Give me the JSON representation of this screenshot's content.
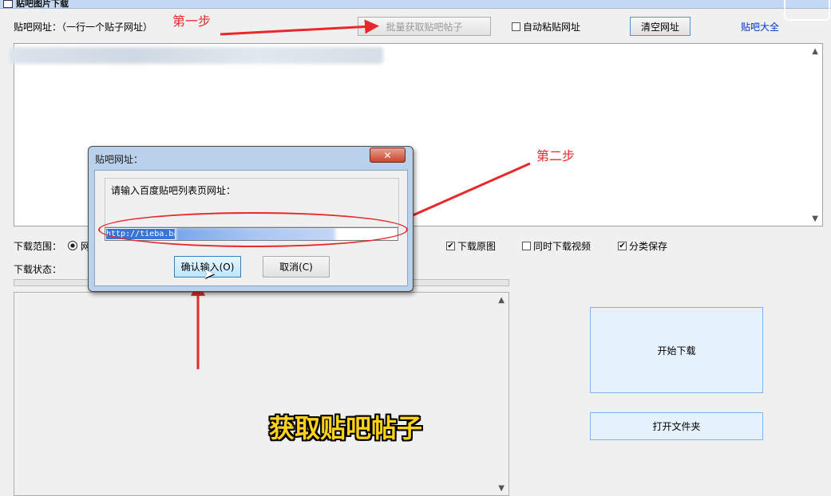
{
  "window": {
    "title": "贴吧图片下载"
  },
  "header": {
    "url_label": "贴吧网址：（一行一个贴子网址）",
    "batch_button": "批量获取贴吧帖子",
    "auto_paste_label": "自动粘贴网址",
    "auto_paste_checked": false,
    "clear_button": "清空网址",
    "tieba_link": "贴吧大全"
  },
  "options": {
    "range_label": "下载范围：",
    "range_option_prefix": "网",
    "original_label": "下载原图",
    "original_checked": true,
    "video_label": "同时下载视频",
    "video_checked": false,
    "classify_label": "分类保存",
    "classify_checked": true
  },
  "status": {
    "label": "下载状态："
  },
  "actions": {
    "start_button": "开始下载",
    "open_folder_button": "打开文件夹"
  },
  "dialog": {
    "title": "贴吧网址：",
    "close_glyph": "✕",
    "prompt": "请输入百度贴吧列表页网址：",
    "input_value": "http://tieba.ba",
    "ok_button": "确认输入(O)",
    "cancel_button": "取消(C)"
  },
  "annotations": {
    "step1": "第一步",
    "step2": "第二步",
    "caption": "获取贴吧帖子"
  },
  "colors": {
    "annotation_red": "#e8282b",
    "caption_yellow": "#ffd21a",
    "button_blue": "#7eb4ea"
  }
}
